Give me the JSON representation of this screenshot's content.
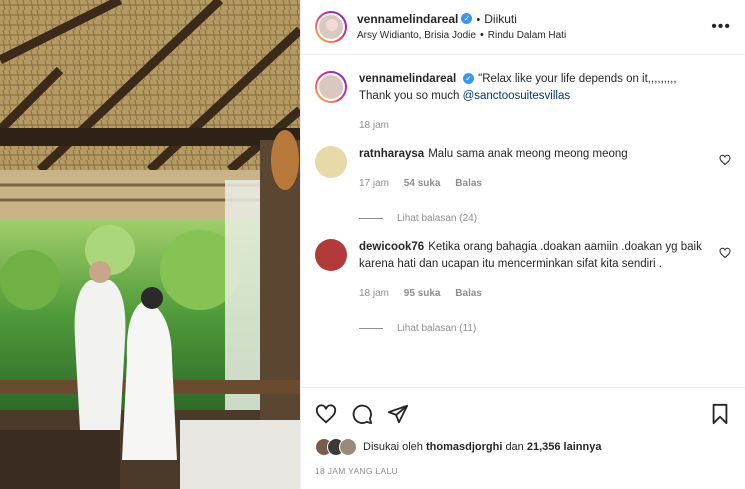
{
  "header": {
    "username": "vennamelindareal",
    "follow_status": "Diikuti",
    "subtitle_left": "Arsy Widianto, Brisia Jodie",
    "subtitle_right": "Rindu Dalam Hati",
    "more_icon": "more-horizontal-icon"
  },
  "caption": {
    "username": "vennamelindareal",
    "text": "\"Relax like your life depends on it,,,,,,,,, Thank you so much ",
    "mention": "@sanctoosuitesvillas",
    "time": "18 jam"
  },
  "comments": [
    {
      "username": "ratnharaysa",
      "text": "Malu sama anak meong meong meong",
      "time": "17 jam",
      "likes": "54 suka",
      "reply": "Balas",
      "view_replies": "Lihat balasan (24)",
      "avatar_color": "#e8d9a8"
    },
    {
      "username": "dewicook76",
      "text": "Ketika orang bahagia .doakan aamiin .doakan yg baik karena hati dan ucapan itu mencerminkan sifat kita sendiri .",
      "time": "18 jam",
      "likes": "95 suka",
      "reply": "Balas",
      "view_replies": "Lihat balasan (11)",
      "avatar_color": "#b23a3a"
    }
  ],
  "actions": {
    "like_icon": "heart-icon",
    "comment_icon": "comment-icon",
    "share_icon": "send-icon",
    "save_icon": "bookmark-icon"
  },
  "likes": {
    "prefix": "Disukai oleh",
    "user": "thomasdjorghi",
    "connector": "dan",
    "count": "21,356 lainnya"
  },
  "posted": "18 JAM YANG LALU",
  "colors": {
    "link": "#00376b",
    "muted": "#8e8e8e",
    "verified": "#3897f0"
  }
}
